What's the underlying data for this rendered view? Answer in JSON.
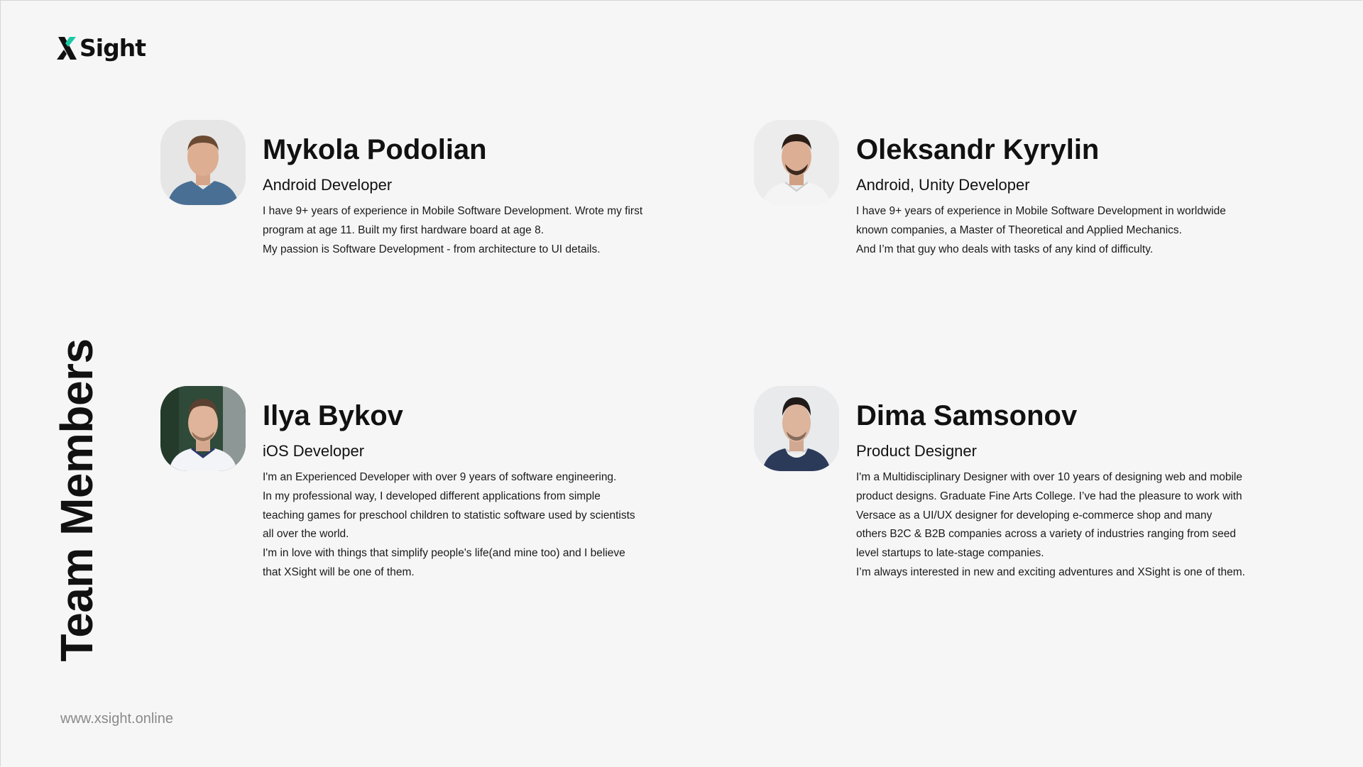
{
  "brand": {
    "logo_text": "Sight",
    "accent_color": "#19c9a6"
  },
  "section_title": "Team Members",
  "website": "www.xsight.online",
  "members": [
    {
      "name": "Mykola Podolian",
      "role": "Android Developer",
      "bio": [
        "I have 9+ years of experience in Mobile Software Development. Wrote my first",
        "program at age 11.  Built my first hardware board at age 8.",
        "My passion is Software Development - from architecture to UI details."
      ]
    },
    {
      "name": "Oleksandr Kyrylin",
      "role": "Android, Unity Developer",
      "bio": [
        "I have 9+ years of experience in Mobile Software Development in worldwide",
        "known companies, a Master of Theoretical and Applied Mechanics.",
        "And I’m that guy who deals with tasks of any kind of difficulty."
      ]
    },
    {
      "name": "Ilya Bykov",
      "role": "iOS Developer",
      "bio": [
        "I'm an Experienced Developer with over 9 years of software engineering.",
        "In my professional way, I developed different applications from simple",
        "teaching games for preschool children to statistic software used by scientists",
        "all over the world.",
        "I'm in love with things that simplify people's life(and mine too) and I believe",
        "that XSight will be one of them."
      ]
    },
    {
      "name": "Dima Samsonov",
      "role": "Product Designer",
      "bio": [
        "I'm a Multidisciplinary Designer with over 10 years of designing web and mobile",
        "product designs. Graduate Fine Arts College. I’ve had the pleasure to work with",
        "Versace as a UI/UX designer for developing e-commerce shop and many",
        "others B2C & B2B companies across a variety of industries ranging from seed",
        "level startups to late-stage companies.",
        "I’m always interested in new and exciting adventures and XSight is one of them."
      ]
    }
  ]
}
